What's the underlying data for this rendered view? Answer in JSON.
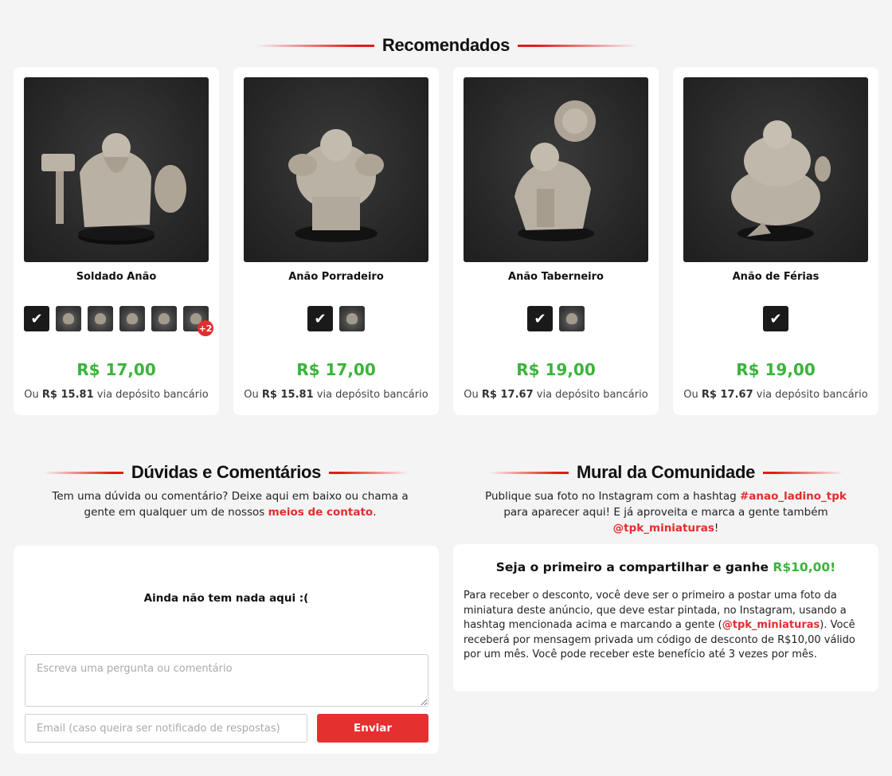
{
  "recommended": {
    "title": "Recomendados",
    "products": [
      {
        "name": "Soldado Anão",
        "price": "R$ 17,00",
        "alt_prefix": "Ou",
        "alt_price": "R$ 15.81",
        "alt_suffix": "via depósito bancário",
        "variant_count": 5,
        "more_badge": "+2"
      },
      {
        "name": "Anão Porradeiro",
        "price": "R$ 17,00",
        "alt_prefix": "Ou",
        "alt_price": "R$ 15.81",
        "alt_suffix": "via depósito bancário",
        "variant_count": 1
      },
      {
        "name": "Anão Taberneiro",
        "price": "R$ 19,00",
        "alt_prefix": "Ou",
        "alt_price": "R$ 17.67",
        "alt_suffix": "via depósito bancário",
        "variant_count": 1
      },
      {
        "name": "Anão de Férias",
        "price": "R$ 19,00",
        "alt_prefix": "Ou",
        "alt_price": "R$ 17.67",
        "alt_suffix": "via depósito bancário",
        "variant_count": 0
      }
    ]
  },
  "questions": {
    "title": "Dúvidas e Comentários",
    "intro_text": "Tem uma dúvida ou comentário? Deixe aqui em baixo ou chama a gente em qualquer um de nossos",
    "intro_link": "meios de contato",
    "intro_end": ".",
    "empty_text": "Ainda não tem nada aqui :(",
    "comment_placeholder": "Escreva uma pergunta ou comentário",
    "email_placeholder": "Email (caso queira ser notificado de respostas)",
    "send_label": "Enviar"
  },
  "community": {
    "title": "Mural da Comunidade",
    "intro_text": "Publique sua foto no Instagram com a hashtag",
    "hashtag": "#anao_ladino_tpk",
    "intro_text2": "para aparecer aqui! E já aproveita e marca a gente também",
    "handle": "@tpk_miniaturas",
    "intro_end": "!",
    "promo_title": "Seja o primeiro a compartilhar e ganhe",
    "promo_amount": "R$10,00!",
    "promo_body_1": "Para receber o desconto, você deve ser o primeiro a postar uma foto da miniatura deste anúncio, que deve estar pintada, no Instagram, usando a hashtag mencionada acima e marcando a gente (",
    "promo_handle": "@tpk_miniaturas",
    "promo_body_2": "). Você receberá por mensagem privada um código de desconto de R$10,00 válido por um mês. Você pode receber este benefício até 3 vezes por mês."
  },
  "colors": {
    "accent_red": "#e22d2d",
    "price_green": "#3ab43a",
    "background": "#f4f4f4"
  }
}
